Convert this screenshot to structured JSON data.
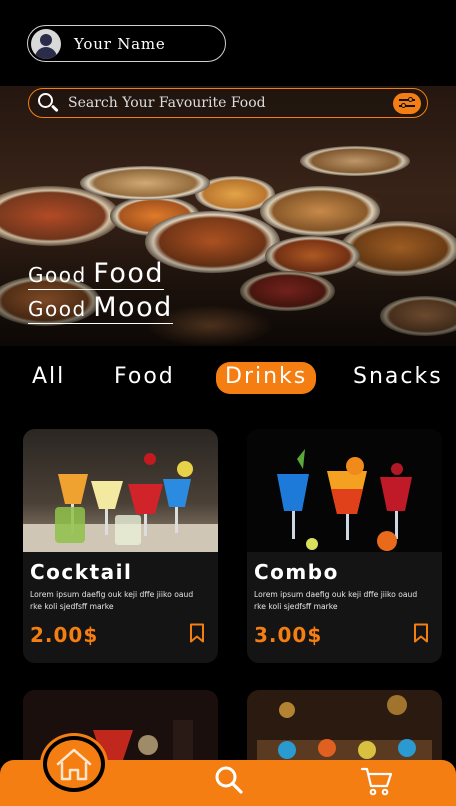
{
  "profile": {
    "name": "Your Name"
  },
  "search": {
    "placeholder": "Search Your Favourite Food"
  },
  "hero": {
    "line1_small": "Good",
    "line1_big": "Food",
    "line2_small": "Good",
    "line2_big": "Mood"
  },
  "categories": [
    {
      "label": "All",
      "active": false
    },
    {
      "label": "Food",
      "active": false
    },
    {
      "label": "Drinks",
      "active": true
    },
    {
      "label": "Snacks",
      "active": false
    }
  ],
  "cards": [
    {
      "title": "Cocktail",
      "description": "Lorem ipsum daefig ouk keji dffe jiiko oaud rke koli sjedfsff marke",
      "price": "2.00$"
    },
    {
      "title": "Combo",
      "description": "Lorem ipsum daefig ouk keji dffe jiiko oaud rke koli sjedfsff marke",
      "price": "3.00$"
    }
  ],
  "nav": {
    "items": [
      "home-icon",
      "search-icon",
      "cart-icon"
    ],
    "active": "home-icon"
  },
  "colors": {
    "accent": "#f47e12",
    "background": "#000000",
    "card": "#141414"
  }
}
